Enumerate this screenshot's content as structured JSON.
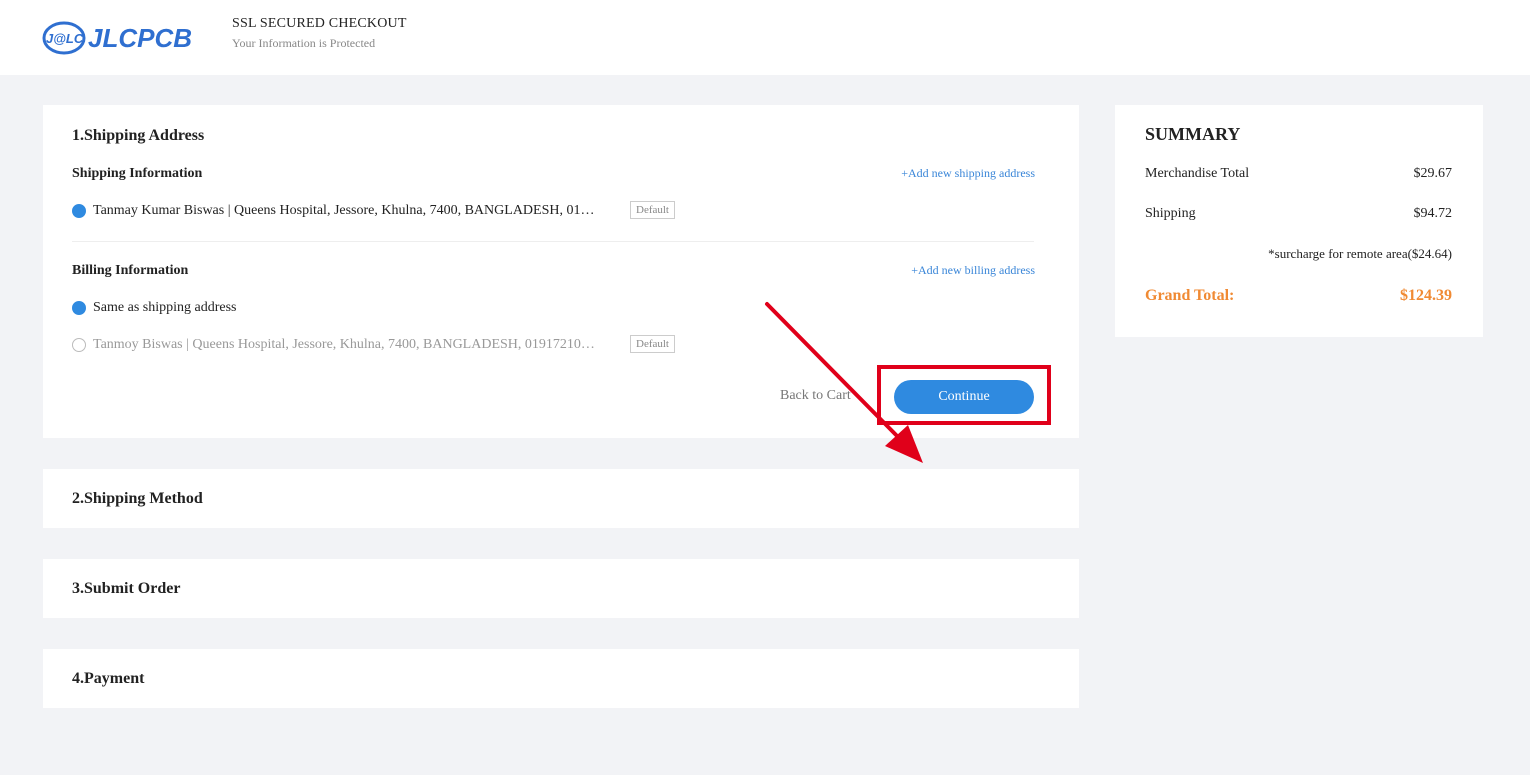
{
  "header": {
    "logo_text": "JLCPCB",
    "logo_mark": "J@LC",
    "ssl_title": "SSL SECURED CHECKOUT",
    "ssl_subtitle": "Your Information is Protected"
  },
  "shipping_address": {
    "title": "1.Shipping Address",
    "shipping_info_label": "Shipping Information",
    "add_shipping_link": "+Add new shipping address",
    "shipping_options": [
      {
        "text": "Tanmay Kumar Biswas | Queens Hospital, Jessore, Khulna, 7400, BANGLADESH, 01…",
        "selected": true,
        "badge": "Default"
      }
    ],
    "billing_info_label": "Billing Information",
    "add_billing_link": "+Add new billing address",
    "billing_options": [
      {
        "text": "Same as shipping address",
        "selected": true
      },
      {
        "text": "Tanmoy Biswas | Queens Hospital, Jessore, Khulna, 7400, BANGLADESH, 01917210…",
        "selected": false,
        "badge": "Default"
      }
    ],
    "back_label": "Back to Cart",
    "continue_label": "Continue"
  },
  "sections": [
    {
      "title": "2.Shipping Method"
    },
    {
      "title": "3.Submit Order"
    },
    {
      "title": "4.Payment"
    }
  ],
  "summary": {
    "title": "SUMMARY",
    "merchandise_label": "Merchandise Total",
    "merchandise_value": "$29.67",
    "shipping_label": "Shipping",
    "shipping_value": "$94.72",
    "surcharge_note": "*surcharge for remote area($24.64)",
    "grand_label": "Grand Total:",
    "grand_value": "$124.39"
  },
  "colors": {
    "accent": "#2f8ae0",
    "link": "#3a86d8",
    "grand_total": "#f08a33",
    "annotation": "#e0001a",
    "background": "#f2f3f6"
  }
}
